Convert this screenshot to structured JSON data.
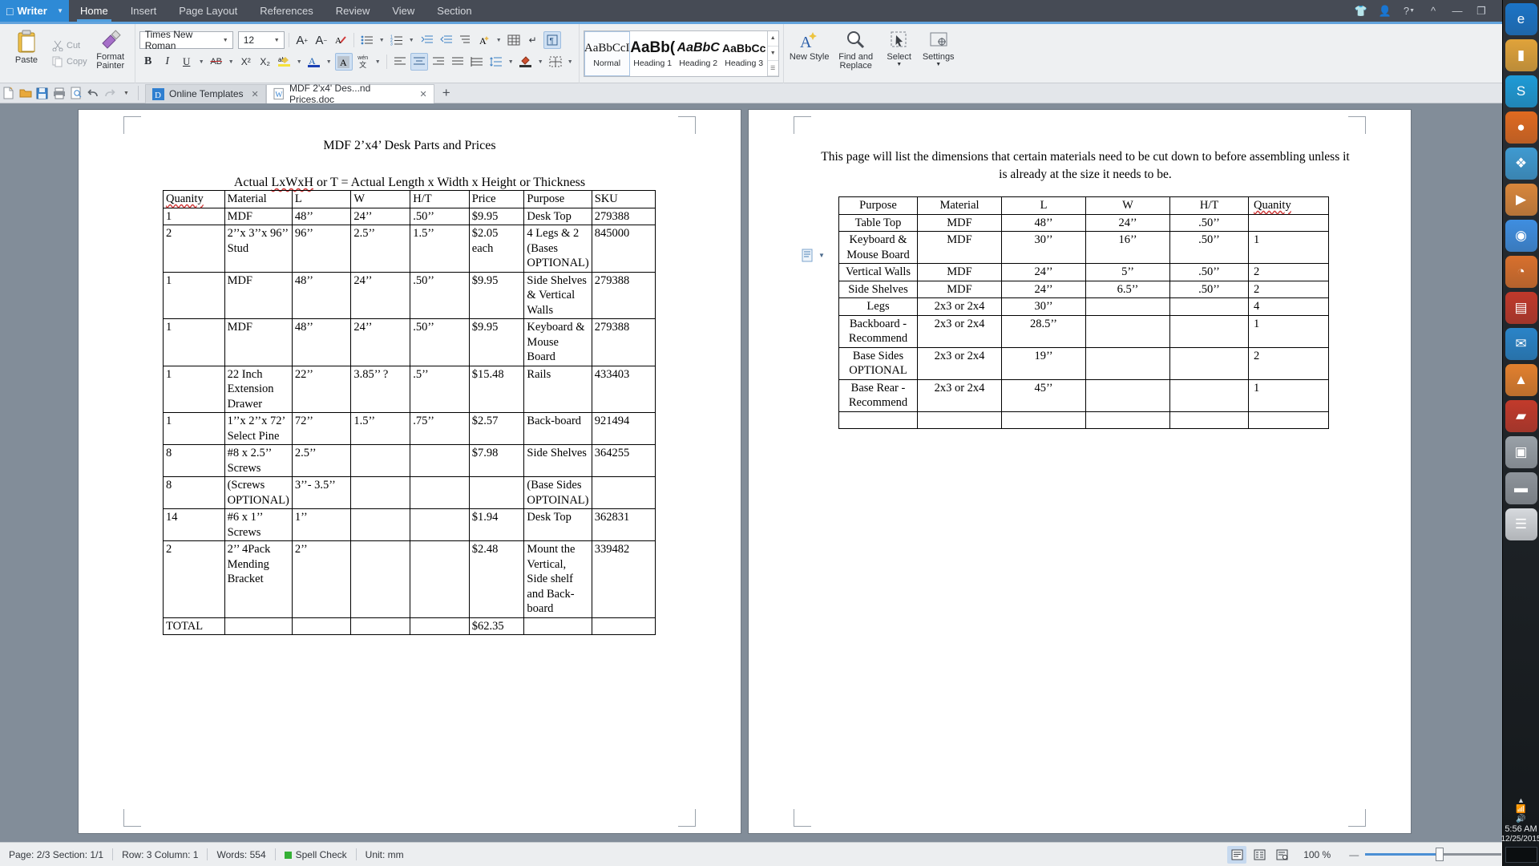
{
  "titlebar": {
    "app_name": "Writer",
    "menu_tabs": [
      "Home",
      "Insert",
      "Page Layout",
      "References",
      "Review",
      "View",
      "Section"
    ],
    "active_tab": "Home",
    "window_buttons": [
      "shirt-icon",
      "user-icon",
      "help-icon",
      "collapse-ribbon-icon",
      "minimize-icon",
      "restore-icon",
      "close-icon"
    ],
    "accent_color": "#62a3dd",
    "brand_color": "#2e8ad6"
  },
  "ribbon": {
    "clipboard": {
      "paste_label": "Paste",
      "cut_label": "Cut",
      "copy_label": "Copy",
      "format_painter_label": "Format Painter"
    },
    "font": {
      "family_value": "Times New Roman",
      "size_value": "12",
      "grow_label": "A+",
      "shrink_label": "A-",
      "clear_format_label": "clear-formatting",
      "bold_label": "B",
      "italic_label": "I",
      "underline_label": "U",
      "strikethrough_label": "AB",
      "superscript_label": "X²",
      "subscript_label": "X₂",
      "highlight_label": "ab",
      "font_color_label": "A",
      "char_shading_label": "A",
      "phonetic_label": "wén"
    },
    "styles_gallery": {
      "items": [
        {
          "preview": "AaBbCcI",
          "name": "Normal",
          "class": "normal"
        },
        {
          "preview": "AaBb(",
          "name": "Heading 1",
          "class": "h1"
        },
        {
          "preview": "AaBbC",
          "name": "Heading 2",
          "class": "h2"
        },
        {
          "preview": "AaBbCc",
          "name": "Heading 3",
          "class": "h3"
        }
      ],
      "selected": "Normal"
    },
    "new_style_label": "New Style",
    "find_replace_label": "Find and Replace",
    "select_label": "Select",
    "settings_label": "Settings"
  },
  "quick_access": {
    "icons": [
      "new-icon",
      "open-icon",
      "save-icon",
      "print-icon",
      "print-preview-icon",
      "undo-icon",
      "redo-icon",
      "customize-icon"
    ],
    "tabs": [
      {
        "label": "Online Templates",
        "icon": "templates-icon",
        "active": false
      },
      {
        "label": "MDF 2'x4' Des...nd Prices.doc",
        "icon": "doc-icon",
        "active": true
      }
    ],
    "new_tab_label": "+"
  },
  "document": {
    "left_page": {
      "title": "MDF 2’x4’ Desk Parts and Prices",
      "subtitle_parts": {
        "pre": "Actual ",
        "misspelled": "LxWxH",
        "post": " or T = Actual Length x Width x Height or Thickness"
      },
      "table": {
        "headers": [
          "Quanity",
          "Material",
          "L",
          "W",
          "H/T",
          "Price",
          "Purpose",
          "SKU"
        ],
        "rows": [
          [
            "1",
            "MDF",
            "48’’",
            "24’’",
            ".50’’",
            "$9.95",
            "Desk Top",
            "279388"
          ],
          [
            "2",
            "2’’x 3’’x 96’’ Stud",
            "96’’",
            "2.5’’",
            "1.5’’",
            "$2.05 each",
            "4 Legs & 2 (Bases OPTIONAL)",
            "845000"
          ],
          [
            "1",
            "MDF",
            "48’’",
            "24’’",
            ".50’’",
            "$9.95",
            "Side Shelves & Vertical Walls",
            "279388"
          ],
          [
            "1",
            "MDF",
            "48’’",
            "24’’",
            ".50’’",
            "$9.95",
            "Keyboard & Mouse Board",
            "279388"
          ],
          [
            "1",
            "22 Inch Extension Drawer",
            "22’’",
            "3.85’’ ?",
            ".5’’",
            "$15.48",
            "Rails",
            "433403"
          ],
          [
            "1",
            "1’’x 2’’x 72’ Select Pine",
            "72’’",
            "1.5’’",
            ".75’’",
            "$2.57",
            "Back-board",
            "921494"
          ],
          [
            "8",
            "#8 x 2.5’’ Screws",
            "2.5’’",
            "",
            "",
            "$7.98",
            "Side Shelves",
            "364255"
          ],
          [
            "8",
            "(Screws OPTIONAL)",
            "3’’- 3.5’’",
            "",
            "",
            "",
            "(Base Sides OPTOINAL)",
            ""
          ],
          [
            "14",
            "#6 x 1’’ Screws",
            "1’’",
            "",
            "",
            "$1.94",
            "Desk Top",
            "362831"
          ],
          [
            "2",
            "2’’ 4Pack Mending Bracket",
            "2’’",
            "",
            "",
            "$2.48",
            "Mount the Vertical, Side shelf and Back-board",
            "339482"
          ],
          [
            "TOTAL",
            "",
            "",
            "",
            "",
            "$62.35",
            "",
            ""
          ]
        ]
      }
    },
    "right_page": {
      "note": "This page will list the dimensions that certain materials need to be cut down to before assembling unless it is already at the size it needs to be.",
      "table": {
        "headers": [
          "Purpose",
          "Material",
          "L",
          "W",
          "H/T",
          "Quanity"
        ],
        "rows": [
          [
            "Table Top",
            "MDF",
            "48’’",
            "24’’",
            ".50’’",
            ""
          ],
          [
            "Keyboard & Mouse Board",
            "MDF",
            "30’’",
            "16’’",
            ".50’’",
            "1"
          ],
          [
            "Vertical Walls",
            "MDF",
            "24’’",
            "5’’",
            ".50’’",
            "2"
          ],
          [
            "Side Shelves",
            "MDF",
            "24’’",
            "6.5’’",
            ".50’’",
            "2"
          ],
          [
            "Legs",
            "2x3 or 2x4",
            "30’’",
            "",
            "",
            "4"
          ],
          [
            "Backboard - Recommend",
            "2x3 or 2x4",
            "28.5’’",
            "",
            "",
            "1"
          ],
          [
            "Base Sides OPTIONAL",
            "2x3 or 2x4",
            "19’’",
            "",
            "",
            "2"
          ],
          [
            "Base Rear - Recommend",
            "2x3 or 2x4",
            "45’’",
            "",
            "",
            "1"
          ],
          [
            "",
            "",
            "",
            "",
            "",
            ""
          ]
        ]
      }
    }
  },
  "statusbar": {
    "page": "Page: 2/3 Section: 1/1",
    "cursor": "Row: 3 Column: 1",
    "words": "Words: 554",
    "spell_check": "Spell Check",
    "spell_check_color": "#35b035",
    "unit": "Unit: mm",
    "zoom": "100 %",
    "view_buttons": [
      "print-layout-icon",
      "outline-icon",
      "web-layout-icon"
    ],
    "zoom_out_label": "—",
    "zoom_in_label": "+"
  },
  "os_dock": {
    "icons": [
      {
        "name": "edge-icon",
        "glyph": "e",
        "color": "#1b74c6"
      },
      {
        "name": "folder-icon",
        "glyph": "▮",
        "color": "#e0a33a"
      },
      {
        "name": "skype-icon",
        "glyph": "S",
        "color": "#1e9bd7"
      },
      {
        "name": "firefox-icon",
        "glyph": "●",
        "color": "#e06a20"
      },
      {
        "name": "photos-icon",
        "glyph": "❖",
        "color": "#3f9ad1"
      },
      {
        "name": "media-player-icon",
        "glyph": "▶",
        "color": "#d8863b"
      },
      {
        "name": "chrome-icon",
        "glyph": "◉",
        "color": "#3f8ee0"
      },
      {
        "name": "ubuntu-icon",
        "glyph": "◔",
        "color": "#d8702d"
      },
      {
        "name": "store-icon",
        "glyph": "▤",
        "color": "#c0392b"
      },
      {
        "name": "mail-icon",
        "glyph": "✉",
        "color": "#2a84c8"
      },
      {
        "name": "vlc-icon",
        "glyph": "▲",
        "color": "#e2802e"
      },
      {
        "name": "pdf-reader-icon",
        "glyph": "▰",
        "color": "#c23a2b"
      },
      {
        "name": "games-icon",
        "glyph": "▣",
        "color": "#9aa1a8"
      },
      {
        "name": "scanner-icon",
        "glyph": "▬",
        "color": "#8e949b"
      },
      {
        "name": "printer-icon",
        "glyph": "☰",
        "color": "#d6d9dd"
      }
    ],
    "tray": {
      "chevron": "▲",
      "network_icon": "network-icon",
      "volume_icon": "volume-icon",
      "time": "5:56 AM",
      "date": "12/25/2015"
    }
  }
}
